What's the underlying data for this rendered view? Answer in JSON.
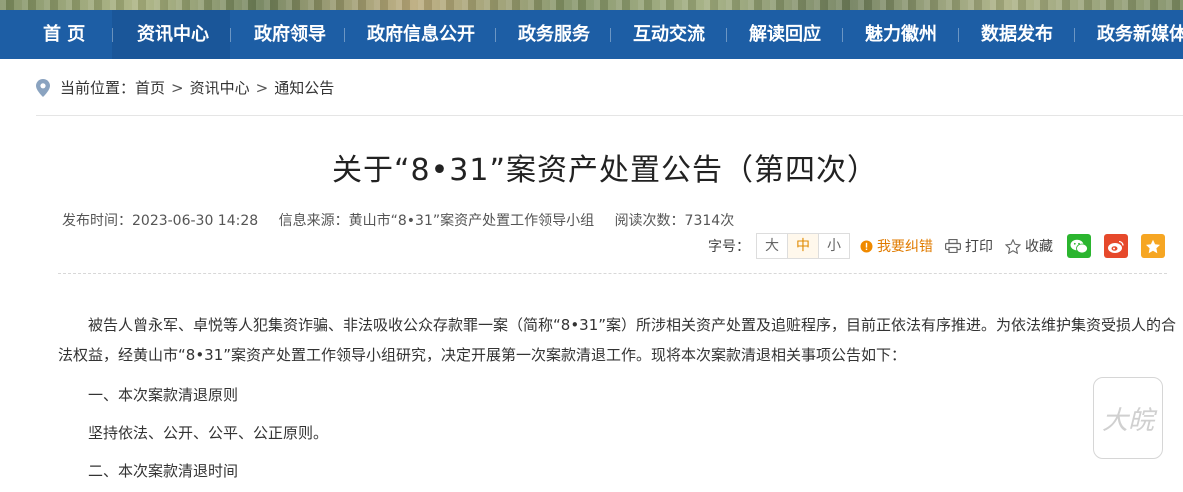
{
  "nav": {
    "items": [
      "首 页",
      "资讯中心",
      "政府领导",
      "政府信息公开",
      "政务服务",
      "互动交流",
      "解读回应",
      "魅力徽州",
      "数据发布",
      "政务新媒体"
    ],
    "active_index": 1
  },
  "breadcrumb": {
    "prefix": "当前位置：",
    "items": [
      "首页",
      "资讯中心",
      "通知公告"
    ],
    "separator": ">"
  },
  "article": {
    "title": "关于“8•31”案资产处置公告（第四次）",
    "publish_time": "发布时间：2023-06-30 14:28",
    "source": "信息来源：黄山市“8•31”案资产处置工作领导小组",
    "views": "阅读次数：7314次"
  },
  "tools": {
    "font_size_label": "字号：",
    "font_sizes": [
      "大",
      "中",
      "小"
    ],
    "active_size": "中",
    "error_report": "我要纠错",
    "print": "打印",
    "favorite": "收藏"
  },
  "colors": {
    "nav_bg": "#1d5ea5",
    "accent_orange": "#e07b00",
    "wechat": "#2bb52f",
    "weibo": "#e6492b",
    "star": "#f6a623"
  },
  "content": {
    "paragraphs": [
      "被告人曾永军、卓悦等人犯集资诈骗、非法吸收公众存款罪一案（简称“8•31”案）所涉相关资产处置及追赃程序，目前正依法有序推进。为依法维护集资受损人的合法权益，经黄山市“8•31”案资产处置工作领导小组研究，决定开展第一次案款清退工作。现将本次案款清退相关事项公告如下：",
      "一、本次案款清退原则",
      "坚持依法、公开、公平、公正原则。",
      "二、本次案款清退时间"
    ]
  },
  "watermark": {
    "text": "大皖"
  }
}
